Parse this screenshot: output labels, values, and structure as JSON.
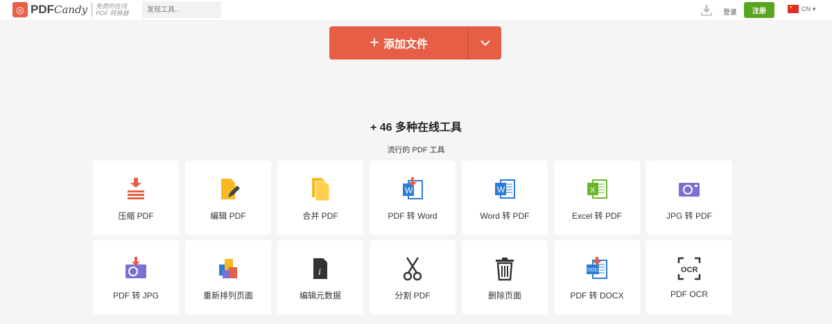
{
  "header": {
    "logo": "PDFCandy",
    "tagline1": "免费的在线",
    "tagline2": "PDF 转换器",
    "search_placeholder": "发现工具..",
    "login": "登录",
    "register": "注册",
    "lang": "CN"
  },
  "main": {
    "add_files": "添加文件",
    "tools_title": "+ 46 多种在线工具",
    "popular": "流行的 PDF 工具"
  },
  "tools": [
    {
      "label": "压缩 PDF",
      "icon": "compress-icon"
    },
    {
      "label": "编辑 PDF",
      "icon": "edit-icon"
    },
    {
      "label": "合并 PDF",
      "icon": "merge-icon"
    },
    {
      "label": "PDF 转 Word",
      "icon": "pdf-to-word-icon"
    },
    {
      "label": "Word 转 PDF",
      "icon": "word-icon"
    },
    {
      "label": "Excel 转 PDF",
      "icon": "excel-icon"
    },
    {
      "label": "JPG 转 PDF",
      "icon": "image-icon"
    },
    {
      "label": "PDF 转 JPG",
      "icon": "pdf-to-image-icon"
    },
    {
      "label": "重新排列页面",
      "icon": "rearrange-icon"
    },
    {
      "label": "编辑元数据",
      "icon": "metadata-icon"
    },
    {
      "label": "分割 PDF",
      "icon": "scissors-icon"
    },
    {
      "label": "删除页面",
      "icon": "trash-icon"
    },
    {
      "label": "PDF 转 DOCX",
      "icon": "docx-icon"
    },
    {
      "label": "PDF OCR",
      "icon": "ocr-icon"
    }
  ]
}
